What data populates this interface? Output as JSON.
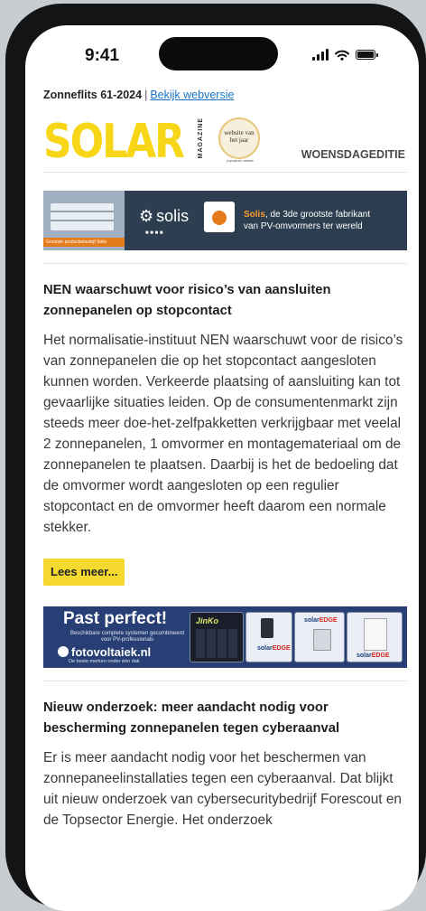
{
  "status": {
    "time": "9:41"
  },
  "newsletter": {
    "issue": "Zonneflits 61-2024",
    "separator": "|",
    "web_link": "Bekijk webversie",
    "logo_text": "SOLAR",
    "logo_vertical": "MAGAZINE",
    "badge_text": "website van het jaar",
    "badge_subtext": "populairste website",
    "edition": "WOENSDAGEDITIE"
  },
  "banner_solis": {
    "brand": "solis",
    "strip_text": "Grootste productiebedrijf Solis",
    "highlight": "Solis",
    "tagline_rest": ", de 3de grootste fabrikant",
    "tagline_line2": "van PV-omvormers ter wereld"
  },
  "articles": [
    {
      "title": "NEN waarschuwt voor risico’s van aansluiten zonnepanelen op stopcontact",
      "body": "Het normalisatie-instituut NEN waarschuwt voor de risico’s van zonnepanelen die op het stopcontact aangesloten kunnen worden. Verkeerde plaatsing of aansluiting kan tot gevaarlijke situaties leiden. Op de consumentenmarkt zijn steeds meer doe-het-zelfpakketten verkrijgbaar met veelal 2 zonnepanelen, 1 omvormer en montagemateriaal om de zonnepanelen te plaatsen. Daarbij is het de bedoeling dat de omvormer wordt aangesloten op een regulier stopcontact en de omvormer heeft daarom een normale stekker.",
      "cta": "Lees meer..."
    },
    {
      "title": "Nieuw onderzoek: meer aandacht nodig voor bescherming zonnepanelen tegen cyberaanval",
      "body": "Er is meer aandacht nodig voor het beschermen van zonnepaneelinstallaties tegen een cyberaanval. Dat blijkt uit nieuw onderzoek van cybersecuritybedrijf Forescout en de Topsector Energie. Het onderzoek"
    }
  ],
  "banner_fotovoltaiek": {
    "headline": "Past perfect!",
    "subline": "Beschikbare complete systemen gecombineerd voor PV-professionals",
    "brand": "fotovoltaiek.nl",
    "tagline": "De beste merken onder één dak",
    "jinko": "JinKo",
    "solar_label": "solar",
    "edge_label": "EDGE"
  }
}
